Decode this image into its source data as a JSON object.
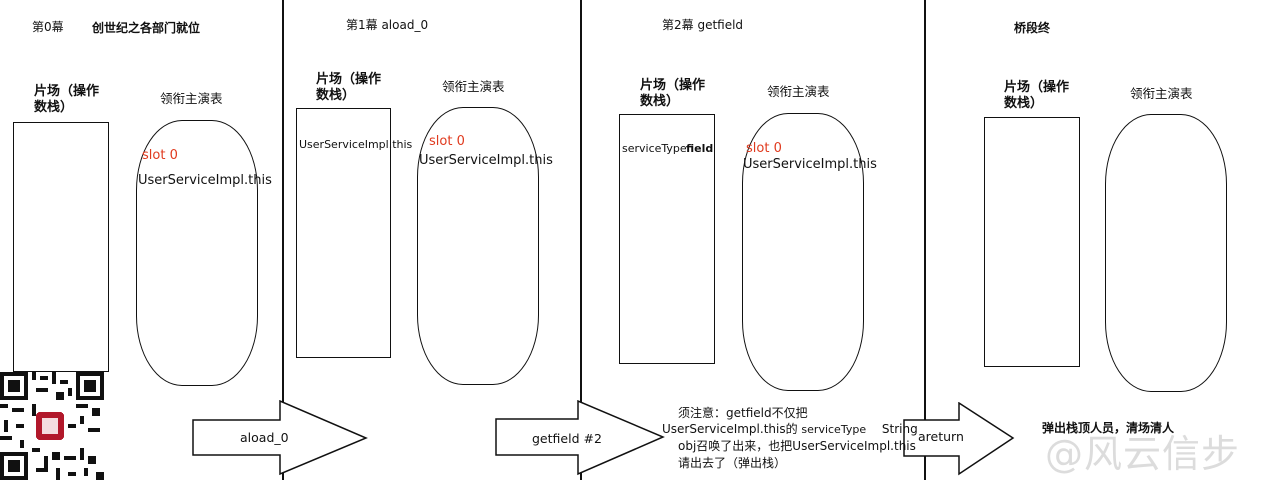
{
  "panels": [
    {
      "title": "第0幕",
      "subtitle": "创世纪之各部门就位",
      "stack_label": "片场（操作数栈）",
      "locals_label": "领衔主演表",
      "locals_slot": "slot 0",
      "locals_value": "UserServiceImpl.this",
      "stack_value": ""
    },
    {
      "title": "第1幕 aload_0",
      "stack_label": "片场（操作数栈）",
      "locals_label": "领衔主演表",
      "locals_slot": "slot 0",
      "locals_value": "UserServiceImpl.this",
      "stack_value": "UserServiceImpl.this"
    },
    {
      "title": "第2幕 getfield",
      "stack_label": "片场（操作数栈）",
      "locals_label": "领衔主演表",
      "locals_slot": "slot 0",
      "locals_value": "UserServiceImpl.this",
      "stack_value_a": "serviceType",
      "stack_value_b": "field"
    },
    {
      "title": "桥段终",
      "stack_label": "片场（操作数栈）",
      "locals_label": "领衔主演表"
    }
  ],
  "arrows": [
    {
      "label": "aload_0"
    },
    {
      "label": "getfield #2"
    },
    {
      "label": "areturn"
    }
  ],
  "notes": {
    "getfield_note_1": "须注意：getfield不仅把",
    "getfield_note_2a": "UserServiceImpl.this的",
    "getfield_note_2b": "serviceType",
    "getfield_note_2c": "String",
    "getfield_note_3": "obj召唤了出来，也把UserServiceImpl.this",
    "getfield_note_4": "请出去了（弹出栈）",
    "areturn_note": "弹出栈顶人员，清场清人"
  },
  "watermark": "@风云信步",
  "colors": {
    "slot": "#e03a1e",
    "line": "#111111",
    "watermark": "#dcdcdc"
  }
}
